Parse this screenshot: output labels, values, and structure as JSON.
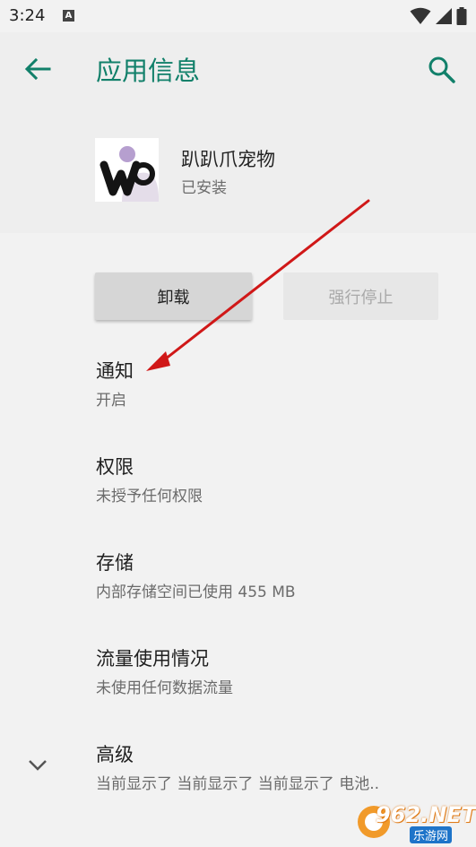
{
  "status_bar": {
    "time": "3:24",
    "notification_letter": "A"
  },
  "app_bar": {
    "title": "应用信息"
  },
  "app": {
    "name": "趴趴爪宠物",
    "status": "已安装"
  },
  "buttons": {
    "uninstall": "卸载",
    "force_stop": "强行停止"
  },
  "settings": [
    {
      "title": "通知",
      "subtitle": "开启"
    },
    {
      "title": "权限",
      "subtitle": "未授予任何权限"
    },
    {
      "title": "存储",
      "subtitle": "内部存储空间已使用 455 MB"
    },
    {
      "title": "流量使用情况",
      "subtitle": "未使用任何数据流量"
    },
    {
      "title": "高级",
      "subtitle": "当前显示了 当前显示了 当前显示了 电池.."
    }
  ],
  "watermark": {
    "number": "962.NET",
    "site": "乐游网"
  },
  "colors": {
    "accent": "#11806a",
    "annotation_arrow": "#d01818"
  }
}
